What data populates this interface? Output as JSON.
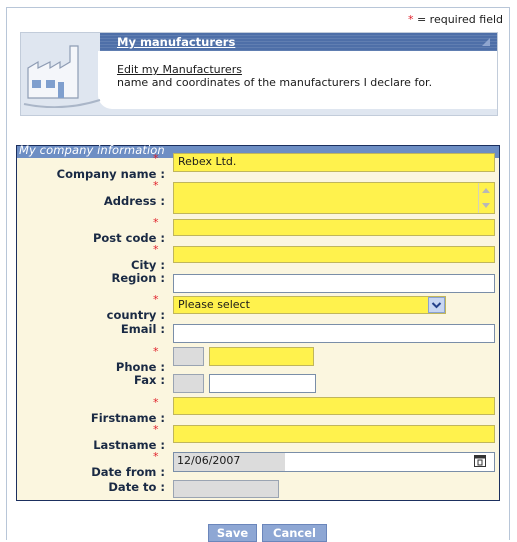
{
  "required_note": {
    "star": "*",
    "text": " = required field"
  },
  "header": {
    "title": "My manufacturers",
    "link": "Edit my Manufacturers",
    "description": "name and coordinates of the manufacturers I declare for.",
    "icon": "factory-icon"
  },
  "form": {
    "section_title": "My company information",
    "required_mark": "*",
    "fields": {
      "company_name": {
        "label": "Company name :",
        "value": "Rebex Ltd."
      },
      "address": {
        "label": "Address :",
        "value": ""
      },
      "post_code": {
        "label": "Post code :",
        "value": ""
      },
      "city": {
        "label": "City :",
        "value": ""
      },
      "region": {
        "label": "Region :",
        "value": ""
      },
      "country": {
        "label": "country :",
        "value": "Please select"
      },
      "email": {
        "label": "Email :",
        "value": ""
      },
      "phone": {
        "label": "Phone :",
        "prefix": "",
        "value": ""
      },
      "fax": {
        "label": "Fax :",
        "prefix": "",
        "value": ""
      },
      "firstname": {
        "label": "Firstname :",
        "value": ""
      },
      "lastname": {
        "label": "Lastname :",
        "value": ""
      },
      "date_from": {
        "label": "Date from :",
        "value": "12/06/2007"
      },
      "date_to": {
        "label": "Date to :",
        "value": ""
      }
    }
  },
  "buttons": {
    "save": "Save",
    "cancel": "Cancel"
  },
  "colors": {
    "required_field": "#fff24d",
    "header_bar": "#4e6fa8",
    "button": "#8ea7d4",
    "asterisk": "#e0202a"
  }
}
